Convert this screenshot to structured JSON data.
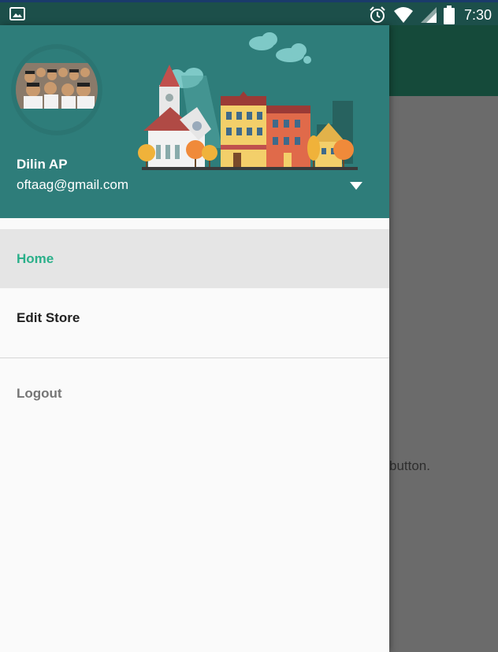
{
  "status_bar": {
    "time": "7:30",
    "icons": [
      "image-icon",
      "alarm-icon",
      "wifi-icon",
      "signal-icon",
      "battery-icon"
    ]
  },
  "background": {
    "partial_text": "button.",
    "toolbar_color": "#154a3a"
  },
  "drawer": {
    "header": {
      "user_name": "Dilin AP",
      "user_email": "oftaag@gmail.com",
      "background_color": "#2e7d7a"
    },
    "menu": {
      "items": [
        {
          "label": "Home",
          "active": true
        },
        {
          "label": "Edit Store",
          "active": false
        }
      ],
      "secondary_items": [
        {
          "label": "Logout"
        }
      ]
    },
    "accent_color": "#2bb08a"
  }
}
